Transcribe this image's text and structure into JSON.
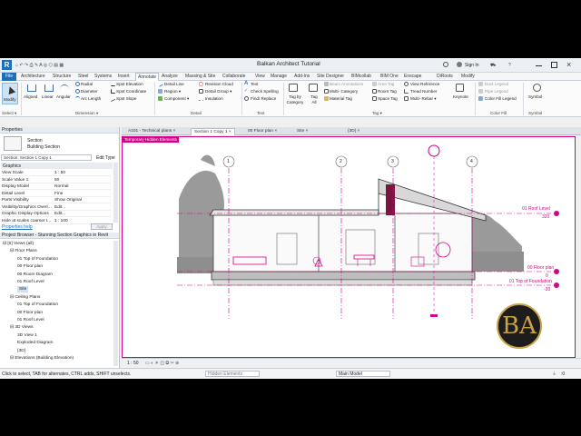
{
  "app": {
    "title": "Balkan Architect Tutorial",
    "sign_in": "Sign In",
    "quick_access": "⌂ ↶ ↷ ⎙ ✎ A ◎ ⬡ ▤ ▦"
  },
  "ribbon_tabs": [
    "File",
    "Architecture",
    "Structure",
    "Steel",
    "Systems",
    "Insert",
    "Annotate",
    "Analyze",
    "Massing & Site",
    "Collaborate",
    "View",
    "Manage",
    "Add-Ins",
    "Site Designer",
    "BIMcollab",
    "BIM One",
    "Enscape",
    "DiRoots",
    "Modify"
  ],
  "ribbon_active": "Annotate",
  "ribbon": {
    "modify": "Modify",
    "select": "Select ▾",
    "dim_tools": [
      "Aligned",
      "Linear",
      "Angular"
    ],
    "dim_col1": [
      "Radial",
      "Diameter",
      "Arc Length"
    ],
    "dim_col2": [
      "Spot Elevation",
      "Spot Coordinate",
      "Spot Slope"
    ],
    "detail_col1": [
      "Detail Line",
      "Region ▾",
      "Component ▾"
    ],
    "detail_col2": [
      "Revision Cloud",
      "Detail Group ▾",
      "Insulation"
    ],
    "text_tools": [
      "Text",
      "Check Spelling",
      "Find/ Replace"
    ],
    "tag_big": [
      "Tag by Category",
      "Tag All"
    ],
    "tag_col1": [
      "Beam Annotations",
      "Multi- Category",
      "Material Tag"
    ],
    "tag_col2": [
      "Area Tag",
      "Room Tag",
      "Space Tag"
    ],
    "tag_col3": [
      "View Reference",
      "Tread Number",
      "Multi- Rebar ▾"
    ],
    "keynote": "Keynote",
    "color_fill": [
      "Duct Legend",
      "Pipe Legend",
      "Color Fill Legend"
    ],
    "symbol": "Symbol",
    "panels": {
      "select": "Select ▾",
      "dimension": "Dimension ▾",
      "detail": "Detail",
      "text": "Text",
      "tag": "Tag ▾",
      "color_fill": "Color Fill",
      "symbol": "Symbol"
    }
  },
  "properties": {
    "header": "Properties",
    "type_name": "Section",
    "type_sub": "Building Section",
    "selector": "Section: Section 1 Copy 1",
    "edit_type": "Edit Type",
    "group": "Graphics",
    "rows": [
      {
        "label": "View Scale",
        "value": "1 : 50"
      },
      {
        "label": "Scale Value 1:",
        "value": "50"
      },
      {
        "label": "Display Model",
        "value": "Normal"
      },
      {
        "label": "Detail Level",
        "value": "Fine"
      },
      {
        "label": "Parts Visibility",
        "value": "Show Original"
      },
      {
        "label": "Visibility/Graphics Overr...",
        "value": "Edit..."
      },
      {
        "label": "Graphic Display Options",
        "value": "Edit..."
      },
      {
        "label": "Hide at scales coarser t...",
        "value": "1 : 100"
      }
    ],
    "help": "Properties help",
    "apply": "Apply"
  },
  "browser": {
    "header": "Project Browser - Stunning Section Graphics in Revit",
    "items": [
      {
        "text": "⊟ [0] Views (all)",
        "indent": 0
      },
      {
        "text": "⊟ Floor Plans",
        "indent": 1
      },
      {
        "text": "01 Top of Foundation",
        "indent": 2
      },
      {
        "text": "00 Floor plan",
        "indent": 2
      },
      {
        "text": "00 Room Diagram",
        "indent": 2
      },
      {
        "text": "01 Roof Level",
        "indent": 2
      },
      {
        "text": "Site",
        "indent": 2
      },
      {
        "text": "⊟ Ceiling Plans",
        "indent": 1
      },
      {
        "text": "01 Top of Foundation",
        "indent": 2
      },
      {
        "text": "00 Floor plan",
        "indent": 2
      },
      {
        "text": "01 Roof Level",
        "indent": 2
      },
      {
        "text": "⊟ 3D Views",
        "indent": 1
      },
      {
        "text": "3D View 1",
        "indent": 2
      },
      {
        "text": "Exploded Diagram",
        "indent": 2
      },
      {
        "text": "{3D}",
        "indent": 2
      },
      {
        "text": "⊟ Elevations (Building Elevation)",
        "indent": 1
      }
    ]
  },
  "view_tabs": [
    {
      "label": "A101 - Technical plans",
      "active": false
    },
    {
      "label": "Section 1 Copy 1",
      "active": true
    },
    {
      "label": "00 Floor plan",
      "active": false
    },
    {
      "label": "Site",
      "active": false
    },
    {
      "label": "{3D}",
      "active": false
    }
  ],
  "canvas": {
    "temp_mode_label": "Temporary Hidden Elements",
    "grids": [
      "1",
      "2",
      "3",
      "4"
    ],
    "levels": [
      {
        "name": "01 Roof Level",
        "value": "320"
      },
      {
        "name": "00 Floor plan",
        "value": "0"
      },
      {
        "name": "01 Top of Foundation",
        "value": "-30"
      }
    ]
  },
  "view_control": {
    "scale": "1 : 50"
  },
  "status": {
    "message": "Click to select, TAB for alternates, CTRL adds, SHIFT unselects.",
    "filter_text": "Hidden Elements",
    "workset": "Main Model",
    "count": ":0"
  },
  "colors": {
    "accent": "#d6008a",
    "file_tab": "#1e6fb8"
  }
}
